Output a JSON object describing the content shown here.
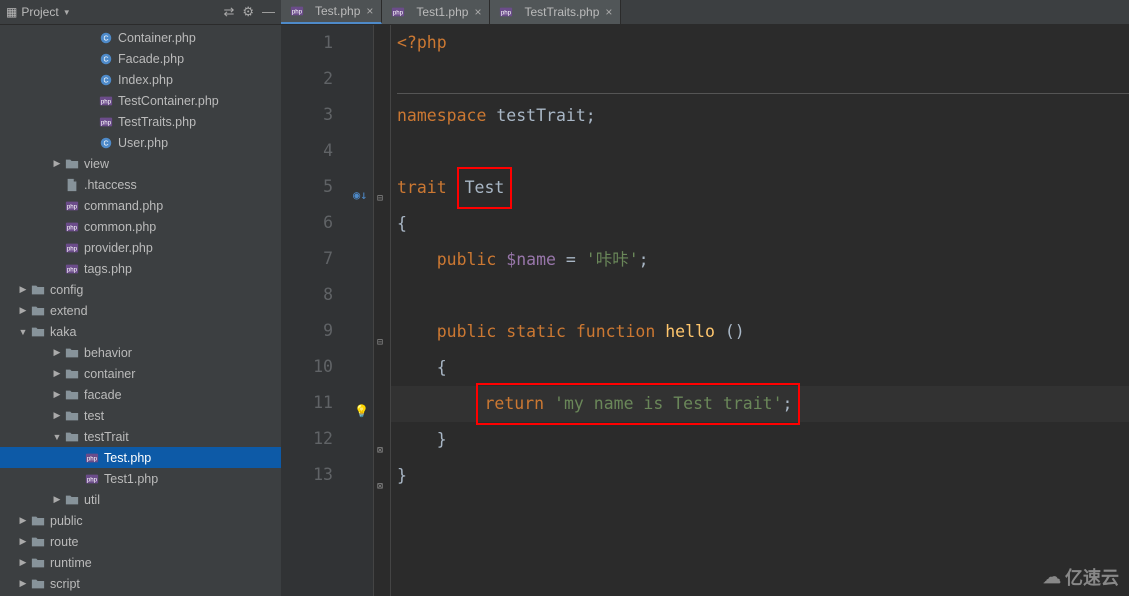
{
  "sidebar": {
    "title": "Project",
    "items": [
      {
        "indent": 84,
        "icon": "phpc",
        "label": "Container.php",
        "arrow": ""
      },
      {
        "indent": 84,
        "icon": "phpc",
        "label": "Facade.php",
        "arrow": ""
      },
      {
        "indent": 84,
        "icon": "phpc",
        "label": "Index.php",
        "arrow": ""
      },
      {
        "indent": 84,
        "icon": "php",
        "label": "TestContainer.php",
        "arrow": ""
      },
      {
        "indent": 84,
        "icon": "php",
        "label": "TestTraits.php",
        "arrow": ""
      },
      {
        "indent": 84,
        "icon": "phpc",
        "label": "User.php",
        "arrow": ""
      },
      {
        "indent": 50,
        "icon": "folder",
        "label": "view",
        "arrow": "right"
      },
      {
        "indent": 50,
        "icon": "file",
        "label": ".htaccess",
        "arrow": ""
      },
      {
        "indent": 50,
        "icon": "php",
        "label": "command.php",
        "arrow": ""
      },
      {
        "indent": 50,
        "icon": "php",
        "label": "common.php",
        "arrow": ""
      },
      {
        "indent": 50,
        "icon": "php",
        "label": "provider.php",
        "arrow": ""
      },
      {
        "indent": 50,
        "icon": "php",
        "label": "tags.php",
        "arrow": ""
      },
      {
        "indent": 16,
        "icon": "folder",
        "label": "config",
        "arrow": "right"
      },
      {
        "indent": 16,
        "icon": "folder",
        "label": "extend",
        "arrow": "right"
      },
      {
        "indent": 16,
        "icon": "folder",
        "label": "kaka",
        "arrow": "down"
      },
      {
        "indent": 50,
        "icon": "folder",
        "label": "behavior",
        "arrow": "right"
      },
      {
        "indent": 50,
        "icon": "folder",
        "label": "container",
        "arrow": "right"
      },
      {
        "indent": 50,
        "icon": "folder",
        "label": "facade",
        "arrow": "right"
      },
      {
        "indent": 50,
        "icon": "folder",
        "label": "test",
        "arrow": "right"
      },
      {
        "indent": 50,
        "icon": "folder",
        "label": "testTrait",
        "arrow": "down"
      },
      {
        "indent": 70,
        "icon": "php",
        "label": "Test.php",
        "arrow": "",
        "selected": true
      },
      {
        "indent": 70,
        "icon": "php",
        "label": "Test1.php",
        "arrow": ""
      },
      {
        "indent": 50,
        "icon": "folder",
        "label": "util",
        "arrow": "right"
      },
      {
        "indent": 16,
        "icon": "folder",
        "label": "public",
        "arrow": "right"
      },
      {
        "indent": 16,
        "icon": "folder",
        "label": "route",
        "arrow": "right"
      },
      {
        "indent": 16,
        "icon": "folder",
        "label": "runtime",
        "arrow": "right"
      },
      {
        "indent": 16,
        "icon": "folder",
        "label": "script",
        "arrow": "right"
      }
    ]
  },
  "tabs": [
    {
      "label": "Test.php",
      "active": true
    },
    {
      "label": "Test1.php",
      "active": false
    },
    {
      "label": "TestTraits.php",
      "active": false
    }
  ],
  "code": {
    "lines": [
      {
        "n": "1",
        "tokens": [
          {
            "c": "kw",
            "t": "<?php"
          }
        ]
      },
      {
        "n": "2",
        "tokens": [],
        "hr": true
      },
      {
        "n": "3",
        "tokens": [
          {
            "c": "kw",
            "t": "namespace "
          },
          {
            "c": "plain",
            "t": "testTrait;"
          }
        ]
      },
      {
        "n": "4",
        "tokens": []
      },
      {
        "n": "5",
        "tokens": [
          {
            "c": "kw",
            "t": "trait "
          },
          {
            "c": "plain",
            "t": "Test",
            "box": true
          }
        ],
        "gi": "◉↓",
        "fold": "⊟"
      },
      {
        "n": "6",
        "tokens": [
          {
            "c": "plain",
            "t": "{"
          }
        ]
      },
      {
        "n": "7",
        "tokens": [
          {
            "c": "plain",
            "t": "    "
          },
          {
            "c": "kw",
            "t": "public "
          },
          {
            "c": "var",
            "t": "$name"
          },
          {
            "c": "plain",
            "t": " = "
          },
          {
            "c": "str",
            "t": "'咔咔'"
          },
          {
            "c": "plain",
            "t": ";"
          }
        ]
      },
      {
        "n": "8",
        "tokens": []
      },
      {
        "n": "9",
        "tokens": [
          {
            "c": "plain",
            "t": "    "
          },
          {
            "c": "kw",
            "t": "public static function "
          },
          {
            "c": "fn",
            "t": "hello "
          },
          {
            "c": "plain",
            "t": "()"
          }
        ],
        "fold": "⊟"
      },
      {
        "n": "10",
        "tokens": [
          {
            "c": "plain",
            "t": "    {"
          }
        ]
      },
      {
        "n": "11",
        "tokens": [
          {
            "c": "plain",
            "t": "        "
          },
          {
            "c": "kw",
            "t": "return "
          },
          {
            "c": "str",
            "t": "'my name is Test trait'"
          },
          {
            "c": "plain",
            "t": ";"
          }
        ],
        "current": true,
        "bulb": true,
        "boxline": true
      },
      {
        "n": "12",
        "tokens": [
          {
            "c": "plain",
            "t": "    }"
          }
        ],
        "fold": "⊠"
      },
      {
        "n": "13",
        "tokens": [
          {
            "c": "plain",
            "t": "}"
          }
        ],
        "fold": "⊠"
      }
    ]
  },
  "watermark": "亿速云"
}
